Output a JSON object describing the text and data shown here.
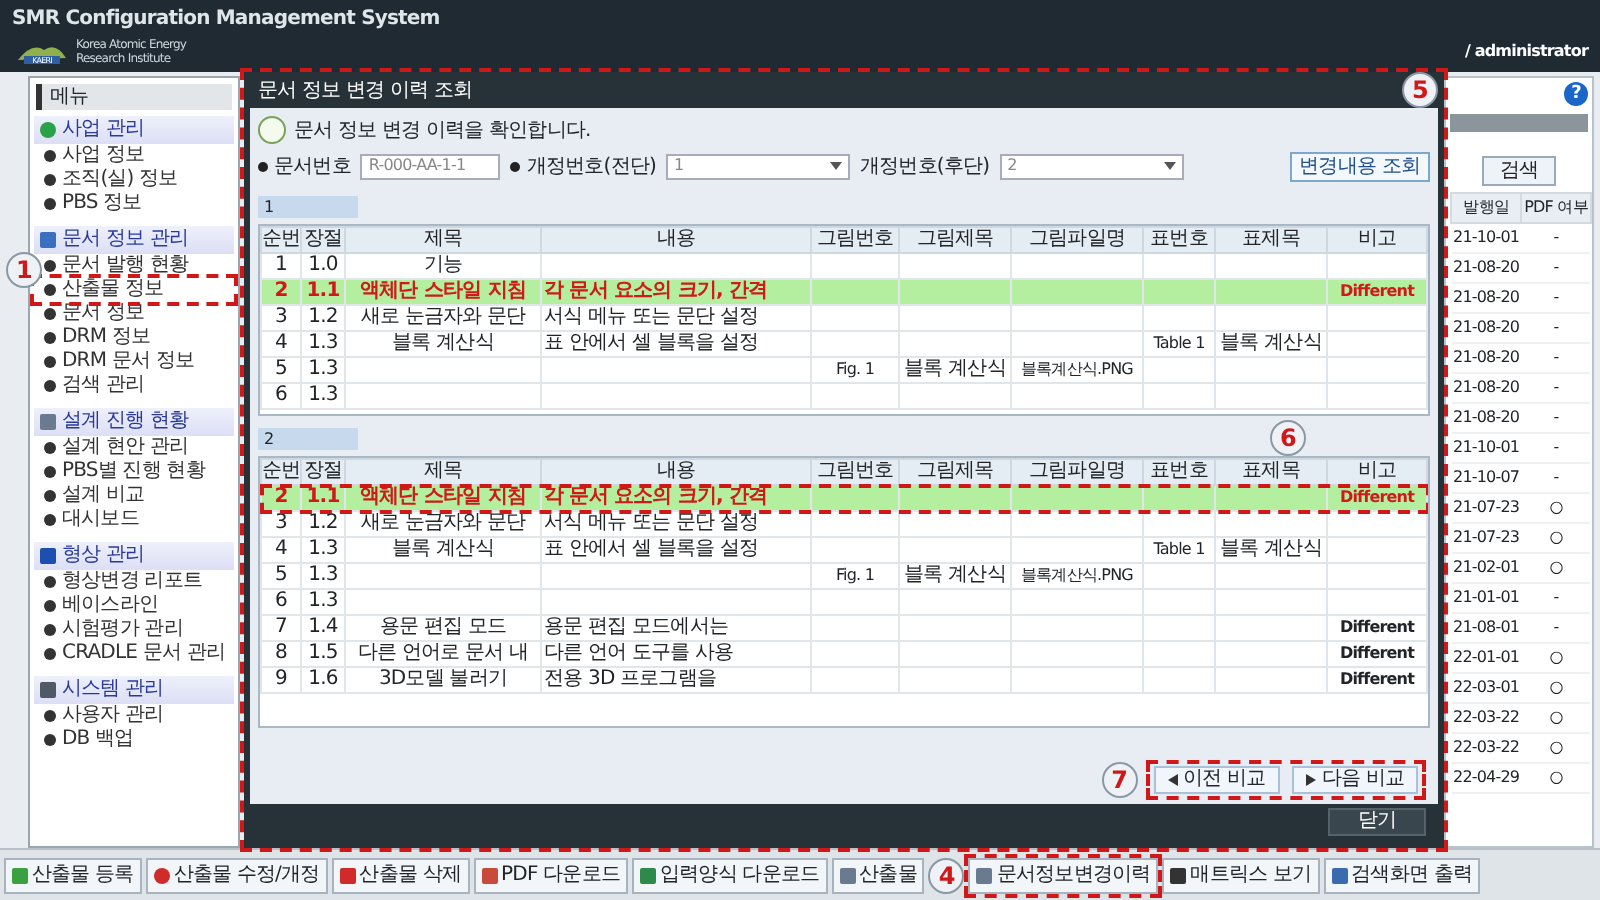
{
  "window": {
    "title": "SMR Configuration Management System",
    "user": "/ administrator",
    "help": "?"
  },
  "logo": {
    "short": "KAERI",
    "org": "Korea Atomic Energy Research Institute"
  },
  "sidebar": {
    "header": "메뉴",
    "groups": [
      {
        "title": "사업 관리",
        "kind": "project",
        "items": [
          {
            "label": "사업 정보",
            "marked": false
          },
          {
            "label": "조직(실) 정보",
            "marked": false
          },
          {
            "label": "PBS 정보",
            "marked": false
          }
        ]
      },
      {
        "title": "문서 정보 관리",
        "kind": "document",
        "callout": "1",
        "items": [
          {
            "label": "문서 발행 현황",
            "marked": false
          },
          {
            "label": "산출물 정보",
            "marked": true
          },
          {
            "label": "문서 정보",
            "marked": false
          },
          {
            "label": "DRM 정보",
            "marked": false
          },
          {
            "label": "DRM 문서 정보",
            "marked": false
          },
          {
            "label": "검색 관리",
            "marked": false
          }
        ]
      },
      {
        "title": "설계 진행 현황",
        "kind": "search",
        "items": [
          {
            "label": "설계 현안 관리",
            "marked": false
          },
          {
            "label": "PBS별 진행 현황",
            "marked": false
          },
          {
            "label": "설계 비교",
            "marked": false
          },
          {
            "label": "대시보드",
            "marked": false
          }
        ]
      },
      {
        "title": "형상 관리",
        "kind": "config",
        "items": [
          {
            "label": "형상변경 리포트",
            "marked": false
          },
          {
            "label": "베이스라인",
            "marked": false
          },
          {
            "label": "시험평가 관리",
            "marked": false
          },
          {
            "label": "CRADLE 문서 관리",
            "marked": false
          }
        ]
      },
      {
        "title": "시스템 관리",
        "kind": "system",
        "items": [
          {
            "label": "사용자 관리",
            "marked": false
          },
          {
            "label": "DB 백업",
            "marked": false
          }
        ]
      }
    ]
  },
  "dialog": {
    "title": "문서 정보 변경 이력 조회",
    "callout": "5",
    "marked": true,
    "info": "문서 정보 변경 이력을 확인합니다.",
    "fields": [
      {
        "label": "문서번호",
        "required": true,
        "kind": "text",
        "value": "R-000-AA-1-1"
      },
      {
        "label": "개정번호(전단)",
        "required": true,
        "kind": "select",
        "value": "1"
      },
      {
        "label": "개정번호(후단)",
        "required": false,
        "kind": "select",
        "value": "2"
      }
    ],
    "query_button": "변경내용 조회",
    "panels": [
      {
        "label": "1",
        "columns": [
          "순번",
          "장절",
          "제목",
          "내용",
          "그림번호",
          "그림제목",
          "그림파일명",
          "표번호",
          "표제목",
          "비고"
        ],
        "rows": [
          {
            "no": "1",
            "section": "1.0",
            "title": "기능",
            "changed": false,
            "marked": false
          },
          {
            "no": "2",
            "section": "1.1",
            "title": "액체단 스타일 지침",
            "content": "각 문서 요소의 크기, 간격",
            "note": "Different",
            "changed": true,
            "marked": false
          },
          {
            "no": "3",
            "section": "1.2",
            "title": "새로 눈금자와 문단",
            "content": "서식 메뉴 또는 문단 설정",
            "changed": false,
            "marked": false
          },
          {
            "no": "4",
            "section": "1.3",
            "title": "블록 계산식",
            "content": "표 안에서 셀 블록을 설정",
            "table_no": "Table 1",
            "table_title": "블록 계산식",
            "changed": false,
            "marked": false
          },
          {
            "no": "5",
            "section": "1.3",
            "fig_no": "Fig. 1",
            "fig_title": "블록 계산식",
            "fig_file": "블록계산식.PNG",
            "changed": false,
            "marked": false
          },
          {
            "no": "6",
            "section": "1.3",
            "changed": false,
            "marked": false
          }
        ]
      },
      {
        "label": "2",
        "callout": "6",
        "columns": [
          "순번",
          "장절",
          "제목",
          "내용",
          "그림번호",
          "그림제목",
          "그림파일명",
          "표번호",
          "표제목",
          "비고"
        ],
        "rows": [
          {
            "no": "2",
            "section": "1.1",
            "title": "액체단 스타일 지침",
            "content": "각 문서 요소의 크기, 간격",
            "note": "Different",
            "changed": true,
            "marked": true
          },
          {
            "no": "3",
            "section": "1.2",
            "title": "새로 눈금자와 문단",
            "content": "서식 메뉴 또는 문단 설정",
            "changed": false,
            "marked": false
          },
          {
            "no": "4",
            "section": "1.3",
            "title": "블록 계산식",
            "content": "표 안에서 셀 블록을 설정",
            "table_no": "Table 1",
            "table_title": "블록 계산식",
            "changed": false,
            "marked": false
          },
          {
            "no": "5",
            "section": "1.3",
            "fig_no": "Fig. 1",
            "fig_title": "블록 계산식",
            "fig_file": "블록계산식.PNG",
            "changed": false,
            "marked": false
          },
          {
            "no": "6",
            "section": "1.3",
            "changed": false,
            "marked": false
          },
          {
            "no": "7",
            "section": "1.4",
            "title": "용문 편집 모드",
            "content": "용문 편집 모드에서는",
            "note": "Different",
            "changed": false,
            "marked": false
          },
          {
            "no": "8",
            "section": "1.5",
            "title": "다른 언어로 문서 내",
            "content": "다른 언어 도구를 사용",
            "note": "Different",
            "changed": false,
            "marked": false
          },
          {
            "no": "9",
            "section": "1.6",
            "title": "3D모델 불러기",
            "content": "전용 3D 프로그램을",
            "note": "Different",
            "changed": false,
            "marked": false
          }
        ]
      }
    ],
    "nav": {
      "callout": "7",
      "marked": true,
      "buttons": [
        {
          "label": "이전 비교",
          "kind": "prev"
        },
        {
          "label": "다음 비교",
          "kind": "next"
        }
      ]
    },
    "close_button": "닫기"
  },
  "right_panel": {
    "search_button": "검색",
    "columns": [
      "발행일",
      "PDF 여부"
    ],
    "rows": [
      [
        "21-10-01",
        "-"
      ],
      [
        "21-08-20",
        "-"
      ],
      [
        "21-08-20",
        "-"
      ],
      [
        "21-08-20",
        "-"
      ],
      [
        "21-08-20",
        "-"
      ],
      [
        "21-08-20",
        "-"
      ],
      [
        "21-08-20",
        "-"
      ],
      [
        "21-10-01",
        "-"
      ],
      [
        "21-10-07",
        "-"
      ],
      [
        "21-07-23",
        "○"
      ],
      [
        "21-07-23",
        "○"
      ],
      [
        "21-02-01",
        "○"
      ],
      [
        "21-01-01",
        "-"
      ],
      [
        "21-08-01",
        "-"
      ],
      [
        "22-01-01",
        "○"
      ],
      [
        "22-03-01",
        "○"
      ],
      [
        "22-03-22",
        "○"
      ],
      [
        "22-03-22",
        "○"
      ],
      [
        "22-04-29",
        "○"
      ]
    ]
  },
  "toolbar": [
    {
      "label": "산출물 등록",
      "kind": "add",
      "marked": false
    },
    {
      "label": "산출물 수정/개정",
      "kind": "edit",
      "marked": false
    },
    {
      "label": "산출물 삭제",
      "kind": "delete",
      "marked": false
    },
    {
      "label": "PDF 다운로드",
      "kind": "pdf",
      "marked": false
    },
    {
      "label": "입력양식 다운로드",
      "kind": "excel",
      "marked": false
    },
    {
      "label": "산출물",
      "kind": "doc",
      "marked": false
    },
    {
      "label": "문서정보변경이력",
      "kind": "history",
      "marked": true,
      "callout": "4"
    },
    {
      "label": "매트릭스 보기",
      "kind": "matrix",
      "marked": false
    },
    {
      "label": "검색화면 출력",
      "kind": "print",
      "marked": false
    }
  ]
}
